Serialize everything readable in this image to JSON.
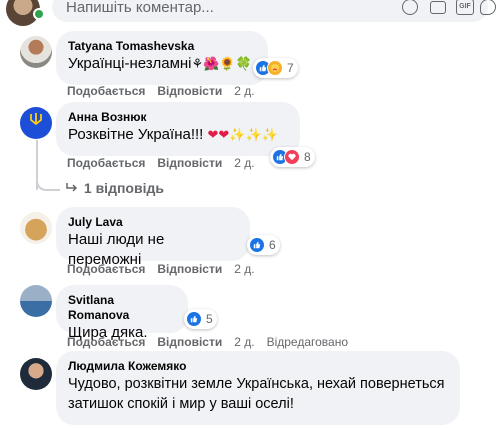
{
  "composer": {
    "placeholder": "Напишіть коментар...",
    "icons": [
      "emoji-icon",
      "camera-icon",
      "gif-icon",
      "sticker-icon"
    ],
    "gif_label": "GIF"
  },
  "actions": {
    "like": "Подобається",
    "reply": "Відповісти",
    "edited": "Відредаговано"
  },
  "comments": [
    {
      "author": "Tatyana Tomashevska",
      "text": "Українці-незламні",
      "emoji": "⚘🌺🌻🍀",
      "time": "2 д.",
      "reactions": "7",
      "reaction_types": [
        "like",
        "care"
      ]
    },
    {
      "author": "Анна Вознюк",
      "text": "Розквітне Україна!!!",
      "emoji": "❤❤✨✨✨",
      "time": "2 д.",
      "reactions": "8",
      "reaction_types": [
        "like",
        "love"
      ]
    },
    {
      "author": "July Lava",
      "text": "Наші люди не переможні",
      "time": "2 д.",
      "reactions": "6",
      "reaction_types": [
        "like"
      ]
    },
    {
      "author": "Svitlana Romanova",
      "text": "Щира дяка.",
      "time": "2 д.",
      "reactions": "5",
      "reaction_types": [
        "like"
      ]
    },
    {
      "author": "Людмила Кожемяко",
      "text_line1": "Чудово, розквітни земле Українська, нехай повернеться",
      "text_line2": "затишок спокій і мир у ваші оселі!"
    }
  ],
  "replies_link": "1 відповідь",
  "colors": {
    "bubble": "#f0f2f5",
    "secondary_text": "#65676b",
    "like_blue": "#1b74e4",
    "love_red": "#f33e58",
    "online_green": "#31a24c"
  }
}
